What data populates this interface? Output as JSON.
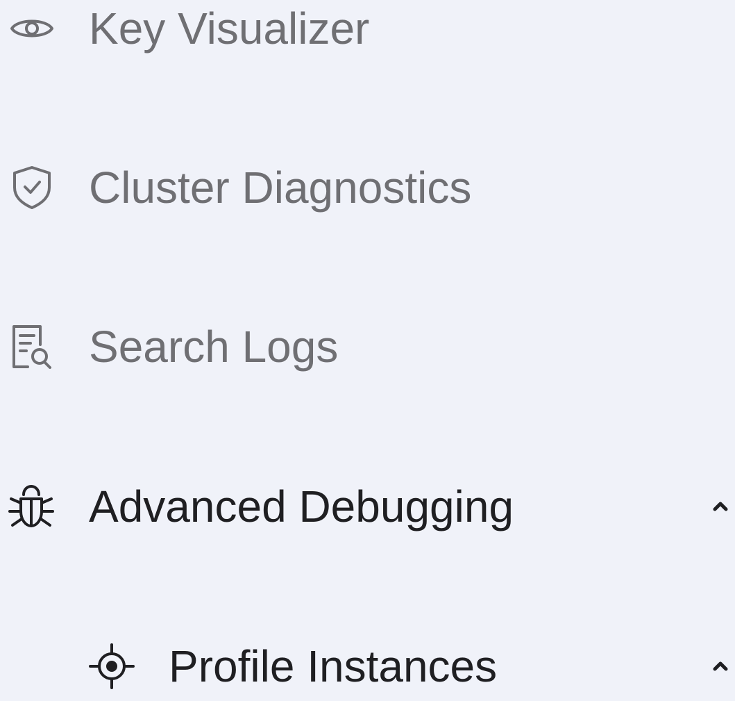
{
  "sidebar": {
    "items": [
      {
        "id": "key-visualizer",
        "label": "Key Visualizer",
        "icon": "eye-icon",
        "state": "muted"
      },
      {
        "id": "cluster-diagnostics",
        "label": "Cluster Diagnostics",
        "icon": "shield-check-icon",
        "state": "muted"
      },
      {
        "id": "search-logs",
        "label": "Search Logs",
        "icon": "log-search-icon",
        "state": "muted"
      },
      {
        "id": "advanced-debugging",
        "label": "Advanced Debugging",
        "icon": "bug-icon",
        "state": "expanded",
        "chevron": "chevron-up-icon"
      },
      {
        "id": "profile-instances",
        "label": "Profile Instances",
        "icon": "crosshair-icon",
        "state": "expanded",
        "chevron": "chevron-up-icon"
      }
    ]
  },
  "colors": {
    "background": "#f0f2f9",
    "muted_text": "#6f6f73",
    "strong_text": "#1f1f22"
  }
}
